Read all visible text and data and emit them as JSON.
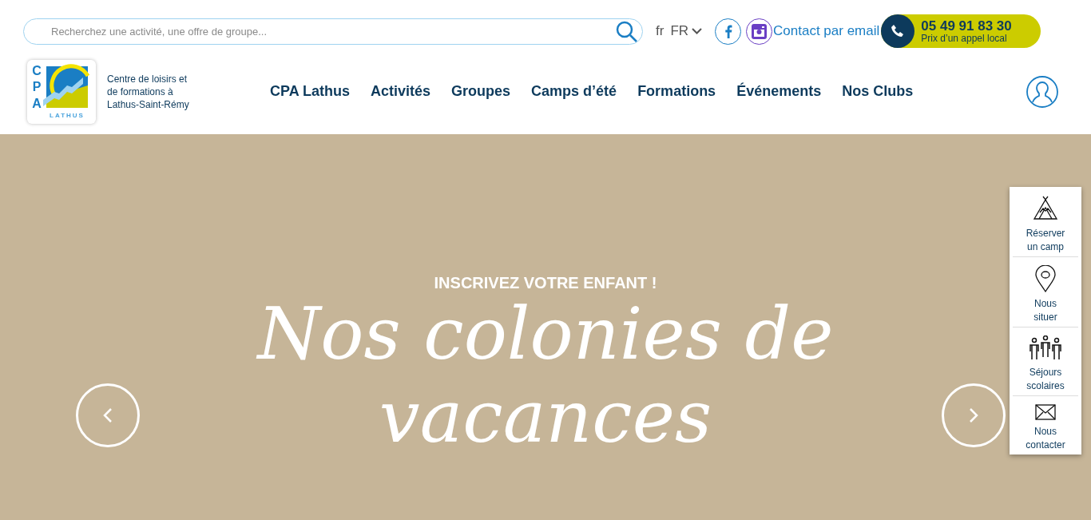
{
  "search": {
    "placeholder": "Recherchez une activité, une offre de groupe..."
  },
  "language": {
    "short": "fr",
    "current": "FR"
  },
  "contact_link": "Contact par email",
  "phone": {
    "number": "05 49 91 83 30",
    "note": "Prix d’un appel local"
  },
  "logo": {
    "letters": [
      "C",
      "P",
      "A"
    ],
    "sub": "LATHUS"
  },
  "tagline": "Centre de loisirs et de formations à Lathus-Saint-Rémy",
  "nav": [
    "CPA Lathus",
    "Activités",
    "Groupes",
    "Camps d’été",
    "Formations",
    "Événements",
    "Nos Clubs"
  ],
  "hero": {
    "kicker": "INSCRIVEZ VOTRE ENFANT !",
    "title": "Nos colonies de vacances"
  },
  "side_menu": [
    {
      "kind": "tent",
      "label": "Réserver un camp"
    },
    {
      "kind": "pin",
      "label": "Nous situer"
    },
    {
      "kind": "people",
      "label": "Séjours scolaires"
    },
    {
      "kind": "mail",
      "label": "Nous contacter"
    }
  ]
}
